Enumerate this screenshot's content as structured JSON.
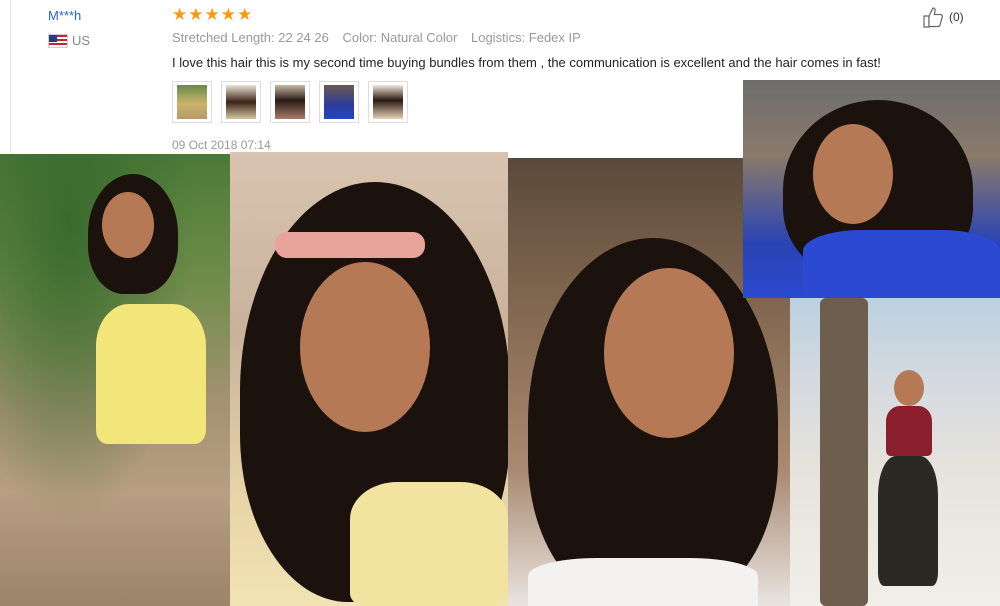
{
  "review": {
    "user": "M***h",
    "country": "US",
    "rating": 5,
    "stars": [
      "★",
      "★",
      "★",
      "★",
      "★"
    ],
    "helpful": {
      "count": "(0)"
    },
    "attributes": [
      "Stretched Length: 22 24 26",
      "Color: Natural Color",
      "Logistics: Fedex IP"
    ],
    "text": "I love this hair this is my second time buying bundles from them , the communication is excellent and the hair comes in fast!",
    "date": "09 Oct 2018 07:14",
    "thumbnail_count": 5
  },
  "colors": {
    "user_link": "#2a64c5",
    "star": "#f39c12",
    "meta_text": "#999999",
    "body_text": "#222222"
  },
  "icons": {
    "helpful": "thumbs-up-icon",
    "flag": "us-flag-icon"
  }
}
